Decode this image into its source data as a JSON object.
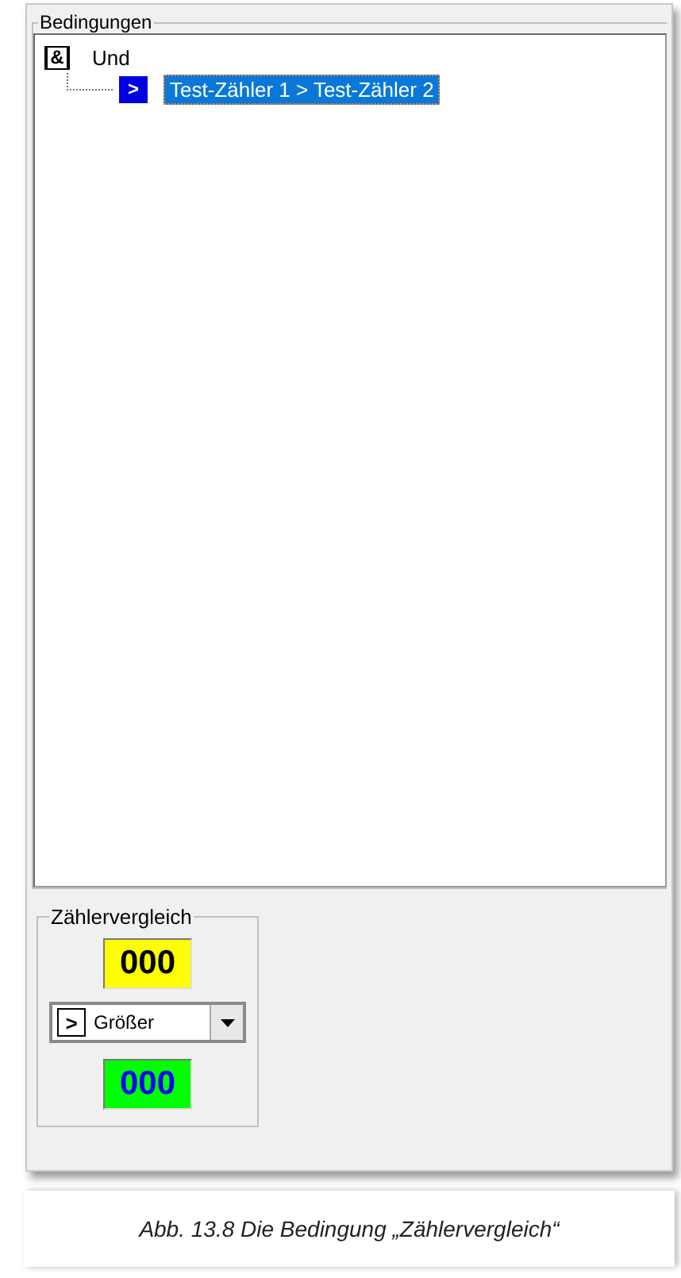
{
  "conditions": {
    "title": "Bedingungen",
    "tree": [
      {
        "kind": "and",
        "icon": "&",
        "label": "Und",
        "selected": false,
        "children": [
          {
            "kind": "compare",
            "icon": ">",
            "label": "Test-Zähler 1 > Test-Zähler 2",
            "selected": true
          }
        ]
      }
    ]
  },
  "counter_compare": {
    "title": "Zählervergleich",
    "value_1": "000",
    "operator": {
      "icon": ">",
      "label": "Größer"
    },
    "value_2": "000"
  },
  "caption": "Abb. 13.8 Die Bedingung „Zählervergleich“"
}
